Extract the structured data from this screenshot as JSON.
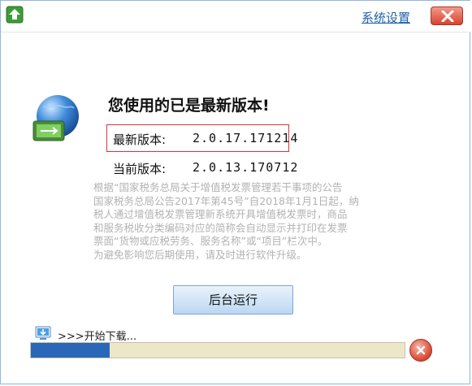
{
  "titlebar": {
    "settings_label": "系统设置"
  },
  "main": {
    "headline": "您使用的已是最新版本!",
    "latest_label": "最新版本:",
    "latest_value": "2.0.17.171214",
    "current_label": "当前版本:",
    "current_value": "2.0.13.170712",
    "notice_lines": [
      "根据“国家税务总局关于增值税发票管理若干事项的公告",
      "国家税务总局公告2017年第45号”自2018年1月1日起，纳",
      "税人通过增值税发票管理新系统开具增值税发票时，商品",
      "和服务税收分类编码对应的简称会自动显示并打印在发票",
      "票面“货物或应税劳务、服务名称”或“项目”栏次中。",
      "为避免影响您后期使用，请及时进行软件升级。"
    ],
    "bg_run_label": "后台运行"
  },
  "download": {
    "status_text": ">>>开始下载...",
    "progress_percent": 21
  },
  "colors": {
    "link": "#1c60a8",
    "highlight_border": "#d9343a",
    "progress_fill": "#2a67b8",
    "notice_text": "#b2b2b2"
  },
  "icons": {
    "app": "upload-arrow-icon",
    "globe": "globe-computer-icon",
    "close": "close-icon",
    "download": "download-icon",
    "cancel": "cancel-icon"
  }
}
